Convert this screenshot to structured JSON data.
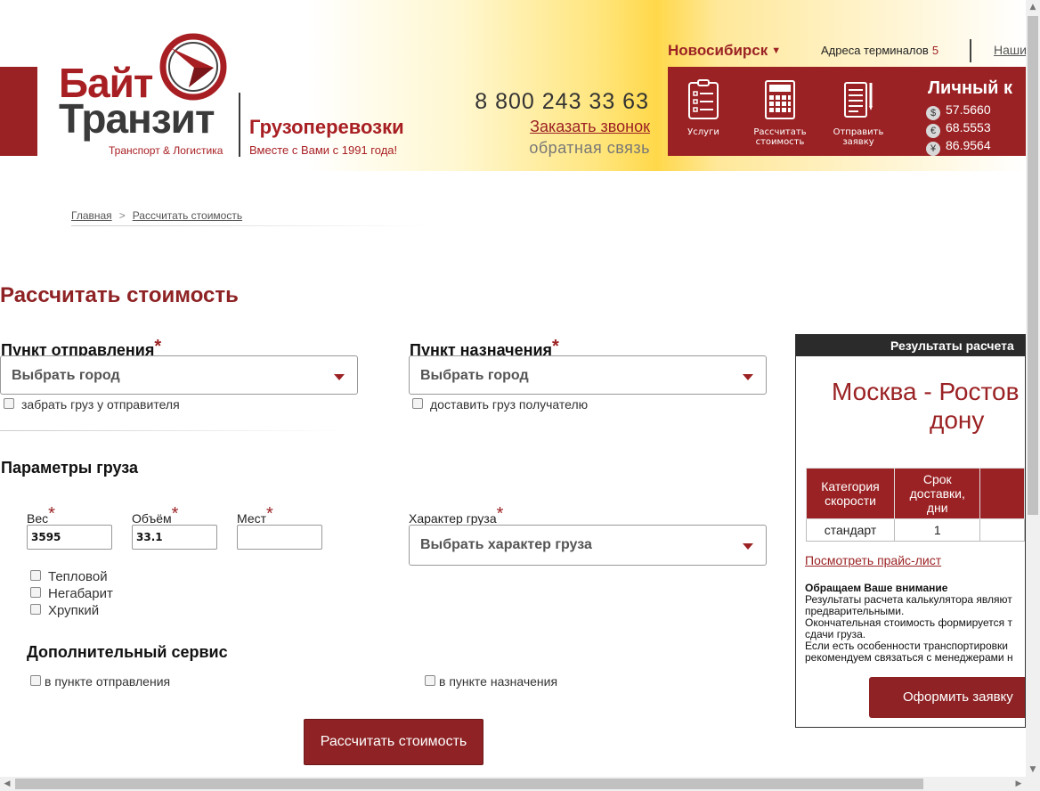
{
  "header": {
    "logo_top": "Байт",
    "logo_bottom": "Транзит",
    "logo_tagline": "Транспорт & Логистика",
    "service": "Грузоперевозки",
    "service_tagline": "Вместе с Вами с 1991 года!",
    "phone": "8 800 243 33 63",
    "callback": "Заказать звонок",
    "feedback": "обратная связь",
    "city": "Новосибирск",
    "terminals_label": "Адреса терминалов",
    "terminals_count": "5",
    "nashi": "Наши",
    "nav": [
      {
        "label": "Услуги"
      },
      {
        "label": "Рассчитать\nстоимость"
      },
      {
        "label": "Отправить\nзаявку"
      }
    ],
    "cabinet": "Личный к",
    "rates": [
      {
        "symbol": "$",
        "value": "57.5660"
      },
      {
        "symbol": "€",
        "value": "68.5553"
      },
      {
        "symbol": "¥",
        "value": "86.9564"
      }
    ]
  },
  "breadcrumb": {
    "home": "Главная",
    "sep": ">",
    "current": "Рассчитать стоимость"
  },
  "title": "Рассчитать стоимость",
  "departure": {
    "label": "Пункт отправления",
    "star": "*",
    "select": "Выбрать город",
    "checkbox": "забрать груз у отправителя"
  },
  "destination": {
    "label": "Пункт назначения",
    "star": "*",
    "select": "Выбрать город",
    "checkbox": "доставить груз получателю"
  },
  "cargo": {
    "title": "Параметры груза",
    "weight_label": "Вес",
    "weight_value": "3595",
    "volume_label": "Объём",
    "volume_value": "33.1",
    "places_label": "Мест",
    "places_value": "",
    "nature_label": "Характер груза",
    "nature_select": "Выбрать характер груза",
    "options": [
      "Тепловой",
      "Негабарит",
      "Хрупкий"
    ]
  },
  "extra": {
    "title": "Дополнительный сервис",
    "origin": "в пункте отправления",
    "dest": "в пункте назначения"
  },
  "calc_button": "Рассчитать стоимость",
  "results": {
    "head": "Результаты расчета",
    "route_line1": "Москва - Ростов",
    "route_line2": "дону",
    "table_headers": [
      "Категория скорости",
      "Срок доставки, дни"
    ],
    "table_rows": [
      [
        "стандарт",
        "1"
      ]
    ],
    "price_link": "Посмотреть прайс-лист",
    "note_title": "Обращаем Ваше внимание",
    "note_lines": [
      "Результаты расчета калькулятора являют",
      "предварительными.",
      "Окончательная стоимость формируется т",
      "сдачи груза.",
      "Если есть особенности транспортировки",
      "рекомендуем связаться с менеджерами н"
    ],
    "order_button": "Оформить заявку"
  },
  "colors": {
    "brand_red": "#9b2224",
    "dark": "#2b2b2b"
  }
}
